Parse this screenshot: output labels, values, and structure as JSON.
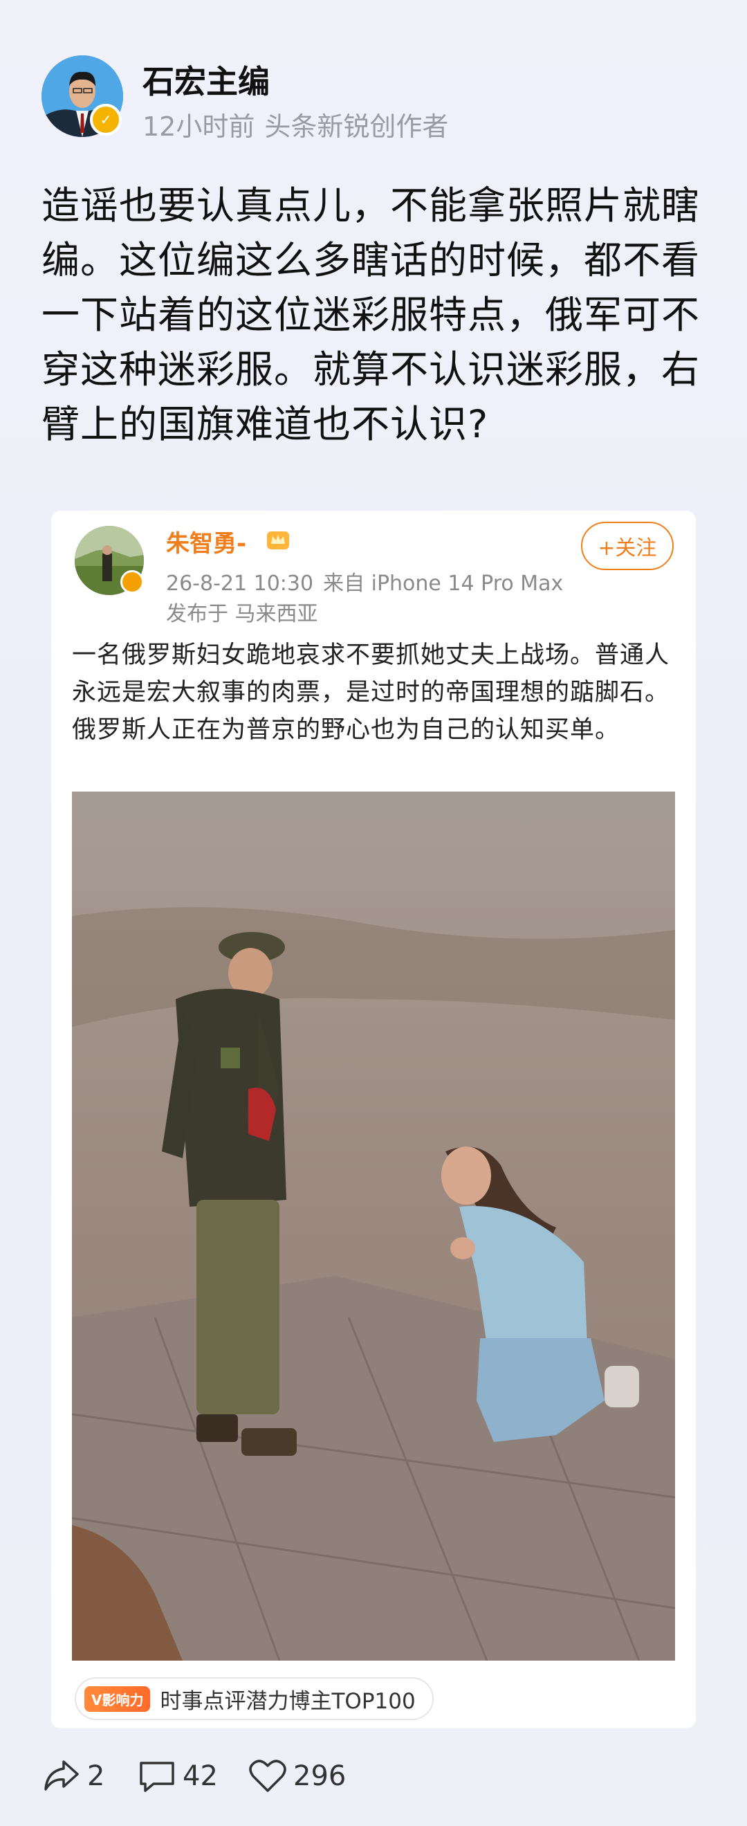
{
  "author": {
    "name": "石宏主编",
    "time": "12小时前",
    "role": "头条新锐创作者"
  },
  "post_text": "造谣也要认真点儿，不能拿张照片就瞎编。这位编这么多瞎话的时候，都不看一下站着的这位迷彩服特点，俄军可不穿这种迷彩服。就算不认识迷彩服，右臂上的国旗难道也不认识?",
  "quoted": {
    "name": "朱智勇-",
    "date": "26-8-21 10:30",
    "source": "来自 iPhone 14 Pro Max",
    "location": "发布于 马来西亚",
    "follow_label": "+关注",
    "text": "一名俄罗斯妇女跪地哀求不要抓她丈夫上战场。普通人永远是宏大叙事的肉票，是过时的帝国理想的踮脚石。俄罗斯人正在为普京的野心也为自己的认知买单。",
    "tag_badge": "V影响力",
    "tag_text": "时事点评潜力博主TOP100"
  },
  "actions": {
    "share_count": "2",
    "comment_count": "42",
    "like_count": "296"
  },
  "colors": {
    "accent": "#f07e1b",
    "badge": "#f4b400",
    "meta": "#9a9aa5"
  },
  "icons": [
    "share-icon",
    "comment-icon",
    "heart-icon",
    "crown-icon",
    "verified-icon"
  ]
}
